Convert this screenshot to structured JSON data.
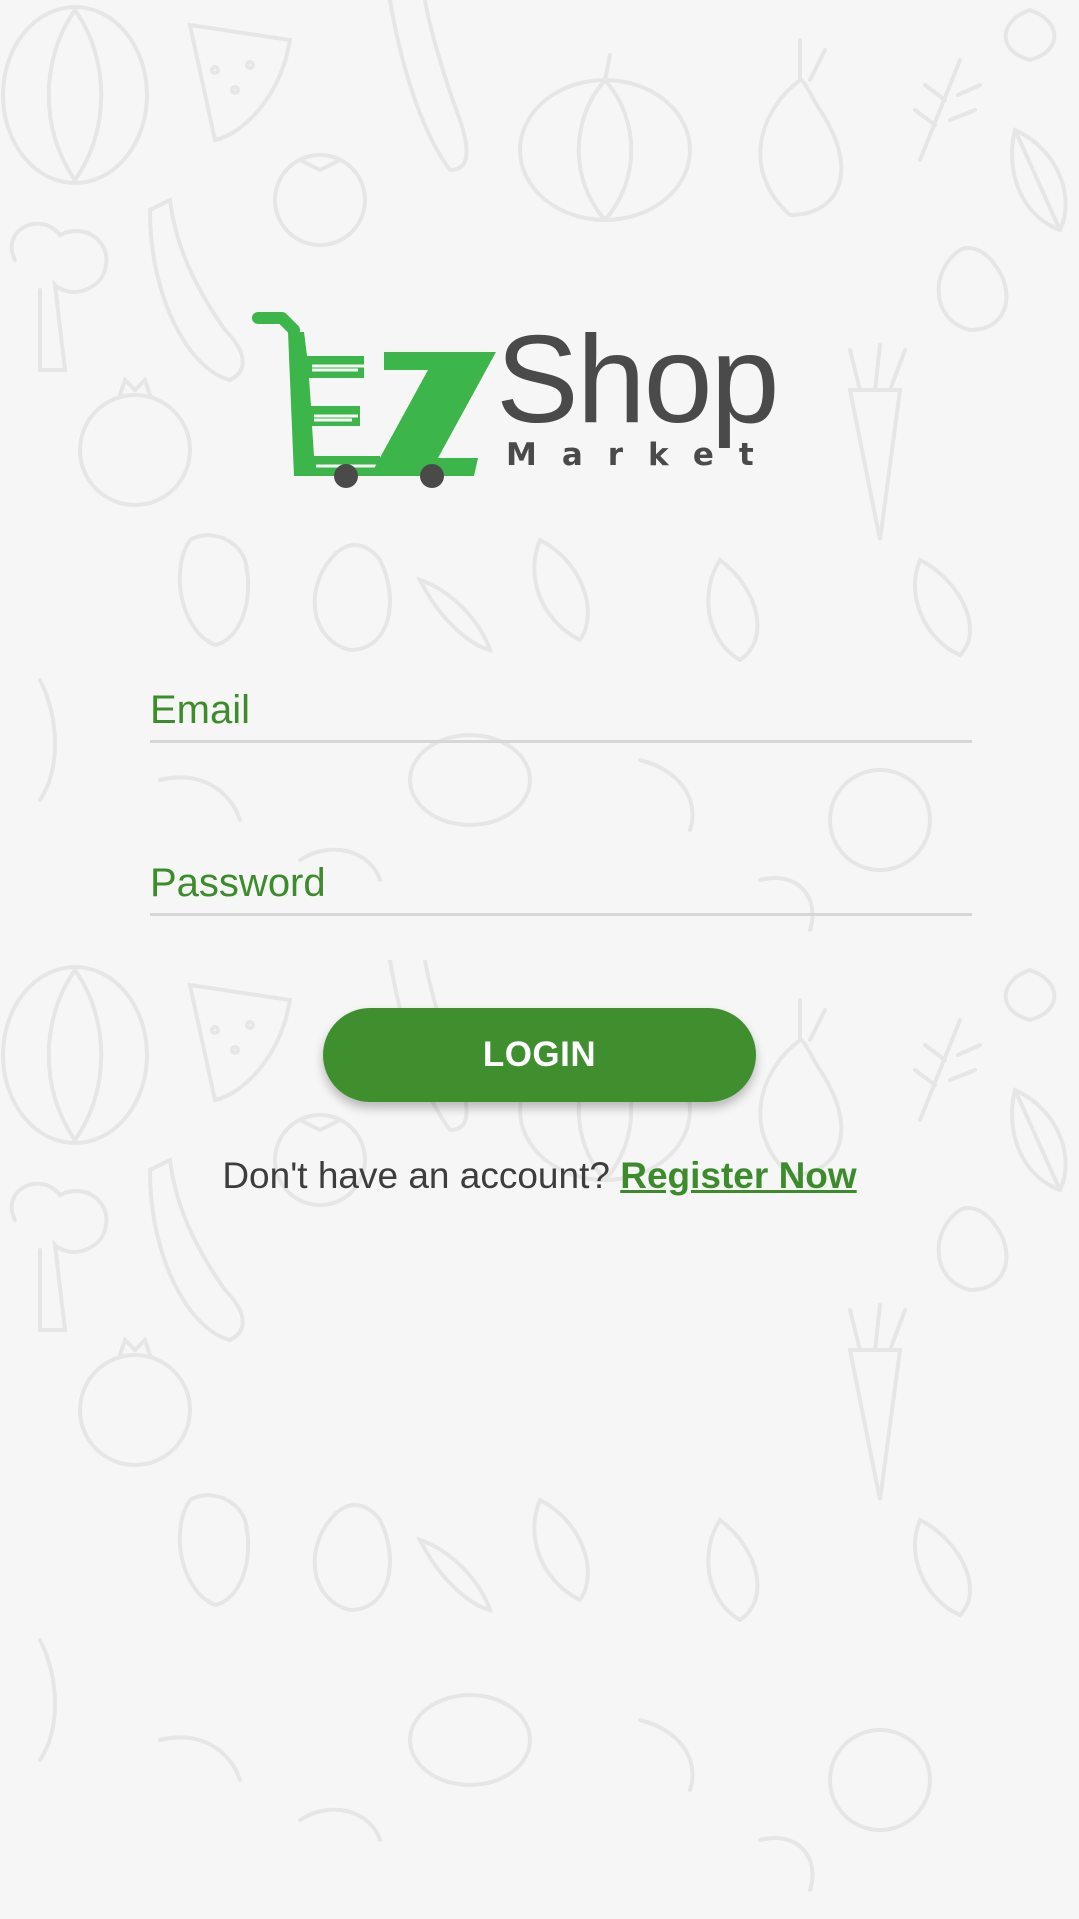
{
  "app": {
    "logo_brand": "EZ",
    "logo_name": "Shop",
    "logo_sub": "Market"
  },
  "form": {
    "email_placeholder": "Email",
    "email_value": "",
    "password_placeholder": "Password",
    "password_value": "",
    "login_label": "LOGIN"
  },
  "register": {
    "prompt": "Don't have an account?",
    "link_label": "Register Now"
  },
  "icons": {
    "logo": "shopping-cart-logo-icon",
    "background": "vegetable-doodle-pattern"
  },
  "colors": {
    "primary_green": "#3f8f2f",
    "logo_green": "#3cb54a",
    "logo_gray": "#4a4a4a",
    "placeholder_green": "#3c8c2c",
    "background": "#f6f6f6"
  }
}
